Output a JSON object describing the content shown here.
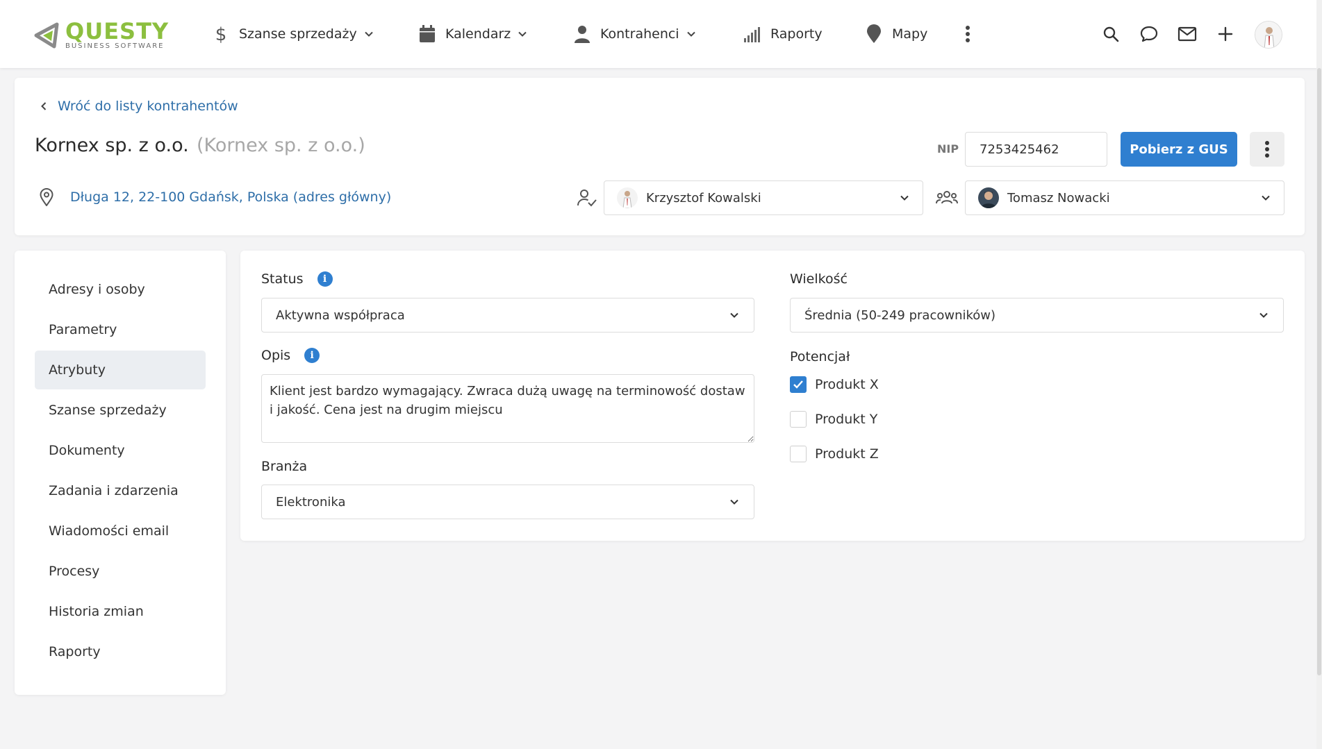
{
  "app": {
    "logo_main": "QUESTY",
    "logo_sub": "BUSINESS SOFTWARE",
    "brand_color": "#8cbf3f",
    "accent_color": "#2f7fd0"
  },
  "nav": {
    "items": [
      {
        "label": "Szanse sprzedaży",
        "icon": "dollar-icon",
        "dropdown": true
      },
      {
        "label": "Kalendarz",
        "icon": "calendar-icon",
        "dropdown": true
      },
      {
        "label": "Kontrahenci",
        "icon": "person-icon",
        "dropdown": true
      },
      {
        "label": "Raporty",
        "icon": "signal-bars-icon",
        "dropdown": false
      },
      {
        "label": "Mapy",
        "icon": "map-pin-icon",
        "dropdown": false
      }
    ],
    "right_icons": [
      "search-icon",
      "chat-icon",
      "mail-icon",
      "plus-icon",
      "user-avatar"
    ]
  },
  "header": {
    "back_label": "Wróć do listy kontrahentów",
    "company_name": "Kornex sp. z o.o.",
    "company_alias": "(Kornex sp. z o.o.)",
    "nip_label": "NIP",
    "nip_value": "7253425462",
    "gus_button": "Pobierz z GUS",
    "address": "Długa 12, 22-100 Gdańsk, Polska (adres główny)",
    "owner": "Krzysztof Kowalski",
    "team_member": "Tomasz Nowacki"
  },
  "sidebar": {
    "items": [
      {
        "label": "Adresy i osoby",
        "active": false
      },
      {
        "label": "Parametry",
        "active": false
      },
      {
        "label": "Atrybuty",
        "active": true
      },
      {
        "label": "Szanse sprzedaży",
        "active": false
      },
      {
        "label": "Dokumenty",
        "active": false
      },
      {
        "label": "Zadania i zdarzenia",
        "active": false
      },
      {
        "label": "Wiadomości email",
        "active": false
      },
      {
        "label": "Procesy",
        "active": false
      },
      {
        "label": "Historia zmian",
        "active": false
      },
      {
        "label": "Raporty",
        "active": false
      }
    ]
  },
  "form": {
    "status_label": "Status",
    "status_value": "Aktywna współpraca",
    "opis_label": "Opis",
    "opis_value": "Klient jest bardzo wymagający. Zwraca dużą uwagę na terminowość dostaw i jakość. Cena jest na drugim miejscu",
    "branza_label": "Branża",
    "branza_value": "Elektronika",
    "wielkosc_label": "Wielkość",
    "wielkosc_value": "Średnia (50-249 pracowników)",
    "potencjal_label": "Potencjał",
    "potencjal_options": [
      {
        "label": "Produkt X",
        "checked": true
      },
      {
        "label": "Produkt Y",
        "checked": false
      },
      {
        "label": "Produkt Z",
        "checked": false
      }
    ]
  }
}
